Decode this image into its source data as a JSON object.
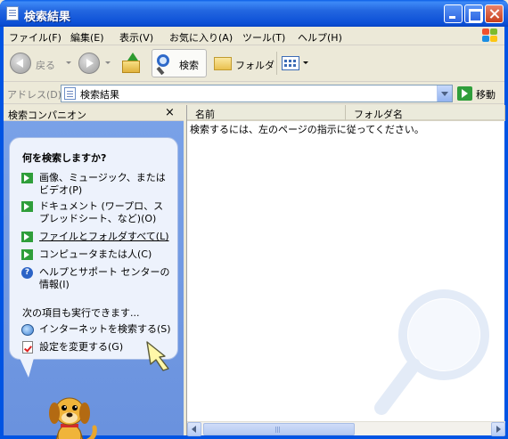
{
  "window": {
    "title": "検索結果"
  },
  "menubar": {
    "items": [
      "ファイル(F)",
      "編集(E)",
      "表示(V)",
      "お気に入り(A)",
      "ツール(T)",
      "ヘルプ(H)"
    ]
  },
  "toolbar": {
    "back_label": "戻る",
    "search_label": "検索",
    "folders_label": "フォルダ"
  },
  "addressbar": {
    "label": "アドレス(D)",
    "value": "検索結果",
    "go_label": "移動"
  },
  "companion": {
    "header": "検索コンパニオン",
    "close": "×",
    "question": "何を検索しますか?",
    "options": [
      "画像、ミュージック、またはビデオ(P)",
      "ドキュメント (ワープロ、スプレッドシート、など)(O)",
      "ファイルとフォルダすべて(L)",
      "コンピュータまたは人(C)",
      "ヘルプとサポート センターの情報(I)"
    ],
    "other_heading": "次の項目も実行できます...",
    "other": [
      "インターネットを検索する(S)",
      "設定を変更する(G)"
    ]
  },
  "results": {
    "columns": [
      "名前",
      "フォルダ名"
    ],
    "message": "検索するには、左のページの指示に従ってください。"
  },
  "colors": {
    "titlebar": "#0a5fe8",
    "companion_bg": "#7aa2e8",
    "go_green": "#2f9e3a"
  }
}
